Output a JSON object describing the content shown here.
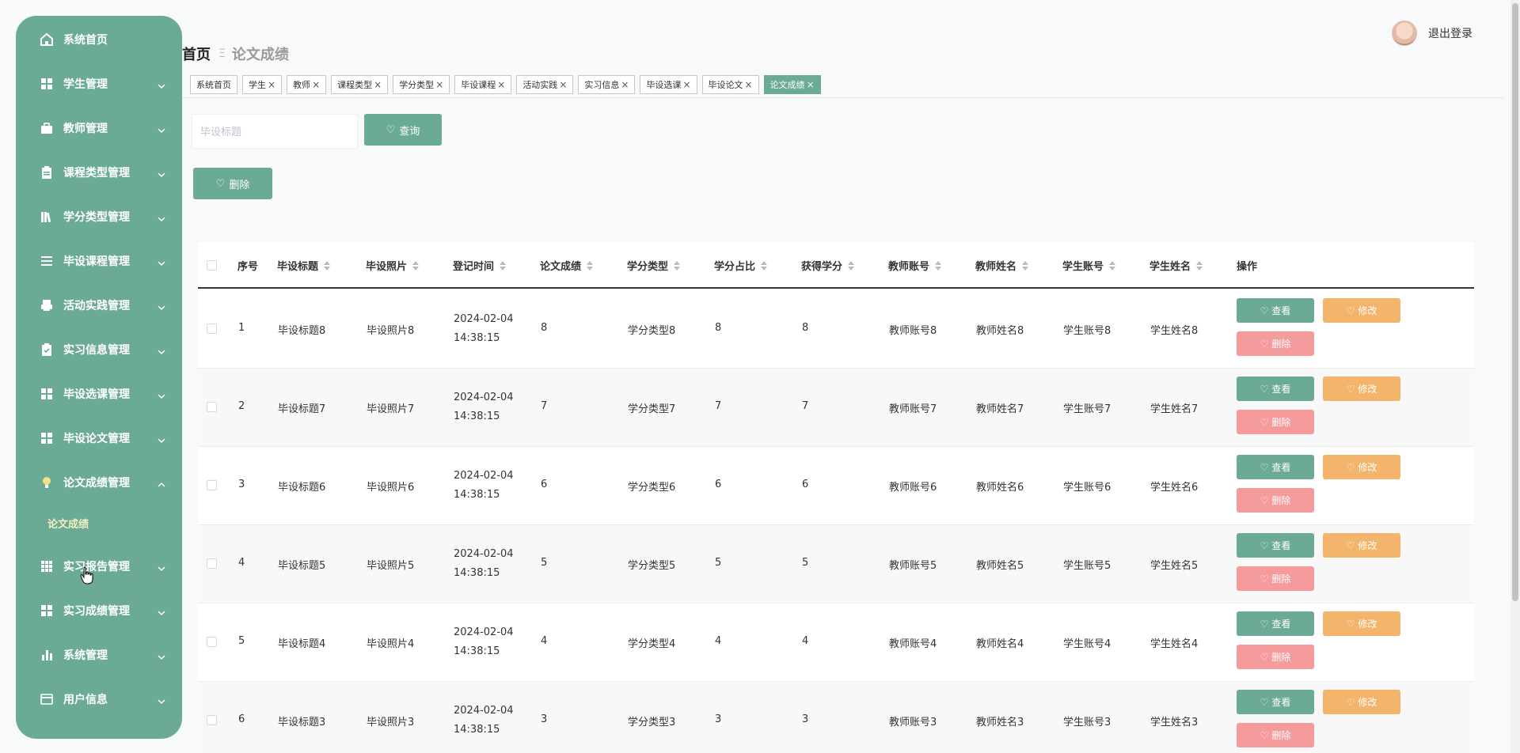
{
  "colors": {
    "primary": "#6aaa96",
    "warning": "#f3b56b",
    "danger": "#f69b9b",
    "submenu_active": "#f3f0c0"
  },
  "sidebar": {
    "items": [
      {
        "label": "系统首页",
        "icon": "home-icon"
      },
      {
        "label": "学生管理",
        "icon": "grid-icon"
      },
      {
        "label": "教师管理",
        "icon": "briefcase-icon"
      },
      {
        "label": "课程类型管理",
        "icon": "clipboard-icon"
      },
      {
        "label": "学分类型管理",
        "icon": "books-icon"
      },
      {
        "label": "毕设课程管理",
        "icon": "list-icon"
      },
      {
        "label": "活动实践管理",
        "icon": "printer-icon"
      },
      {
        "label": "实习信息管理",
        "icon": "clipboard-check-icon"
      },
      {
        "label": "毕设选课管理",
        "icon": "grid-icon"
      },
      {
        "label": "毕设论文管理",
        "icon": "grid-icon"
      },
      {
        "label": "论文成绩管理",
        "icon": "bulb-icon"
      },
      {
        "label": "实习报告管理",
        "icon": "table-icon"
      },
      {
        "label": "实习成绩管理",
        "icon": "grid-icon"
      },
      {
        "label": "系统管理",
        "icon": "bar-chart-icon"
      },
      {
        "label": "用户信息",
        "icon": "card-icon"
      }
    ],
    "submenu_label": "论文成绩"
  },
  "breadcrumb": {
    "home": "首页",
    "separator": "Ξ",
    "current": "论文成绩"
  },
  "header": {
    "logout_label": "退出登录"
  },
  "tabs": [
    {
      "label": "系统首页",
      "closable": false
    },
    {
      "label": "学生",
      "closable": true
    },
    {
      "label": "教师",
      "closable": true
    },
    {
      "label": "课程类型",
      "closable": true
    },
    {
      "label": "学分类型",
      "closable": true
    },
    {
      "label": "毕设课程",
      "closable": true
    },
    {
      "label": "活动实践",
      "closable": true
    },
    {
      "label": "实习信息",
      "closable": true
    },
    {
      "label": "毕设选课",
      "closable": true
    },
    {
      "label": "毕设论文",
      "closable": true
    },
    {
      "label": "论文成绩",
      "closable": true,
      "active": true
    }
  ],
  "tab_close": "×",
  "search": {
    "placeholder": "毕设标题",
    "value": "",
    "button_label": "查询"
  },
  "toolbar": {
    "delete_label": "删除"
  },
  "table": {
    "columns": [
      "序号",
      "毕设标题",
      "毕设照片",
      "登记时间",
      "论文成绩",
      "学分类型",
      "学分占比",
      "获得学分",
      "教师账号",
      "教师姓名",
      "学生账号",
      "学生姓名",
      "操作"
    ],
    "actions": {
      "view": "查看",
      "edit": "修改",
      "delete": "删除"
    },
    "rows": [
      {
        "no": "1",
        "title": "毕设标题8",
        "photo": "毕设照片8",
        "date": "2024-02-04",
        "time": "14:38:15",
        "score": "8",
        "credit_type": "学分类型8",
        "ratio": "8",
        "credits": "8",
        "teacher_acc": "教师账号8",
        "teacher_name": "教师姓名8",
        "student_acc": "学生账号8",
        "student_name": "学生姓名8"
      },
      {
        "no": "2",
        "title": "毕设标题7",
        "photo": "毕设照片7",
        "date": "2024-02-04",
        "time": "14:38:15",
        "score": "7",
        "credit_type": "学分类型7",
        "ratio": "7",
        "credits": "7",
        "teacher_acc": "教师账号7",
        "teacher_name": "教师姓名7",
        "student_acc": "学生账号7",
        "student_name": "学生姓名7"
      },
      {
        "no": "3",
        "title": "毕设标题6",
        "photo": "毕设照片6",
        "date": "2024-02-04",
        "time": "14:38:15",
        "score": "6",
        "credit_type": "学分类型6",
        "ratio": "6",
        "credits": "6",
        "teacher_acc": "教师账号6",
        "teacher_name": "教师姓名6",
        "student_acc": "学生账号6",
        "student_name": "学生姓名6"
      },
      {
        "no": "4",
        "title": "毕设标题5",
        "photo": "毕设照片5",
        "date": "2024-02-04",
        "time": "14:38:15",
        "score": "5",
        "credit_type": "学分类型5",
        "ratio": "5",
        "credits": "5",
        "teacher_acc": "教师账号5",
        "teacher_name": "教师姓名5",
        "student_acc": "学生账号5",
        "student_name": "学生姓名5"
      },
      {
        "no": "5",
        "title": "毕设标题4",
        "photo": "毕设照片4",
        "date": "2024-02-04",
        "time": "14:38:15",
        "score": "4",
        "credit_type": "学分类型4",
        "ratio": "4",
        "credits": "4",
        "teacher_acc": "教师账号4",
        "teacher_name": "教师姓名4",
        "student_acc": "学生账号4",
        "student_name": "学生姓名4"
      },
      {
        "no": "6",
        "title": "毕设标题3",
        "photo": "毕设照片3",
        "date": "2024-02-04",
        "time": "14:38:15",
        "score": "3",
        "credit_type": "学分类型3",
        "ratio": "3",
        "credits": "3",
        "teacher_acc": "教师账号3",
        "teacher_name": "教师姓名3",
        "student_acc": "学生账号3",
        "student_name": "学生姓名3"
      }
    ]
  }
}
